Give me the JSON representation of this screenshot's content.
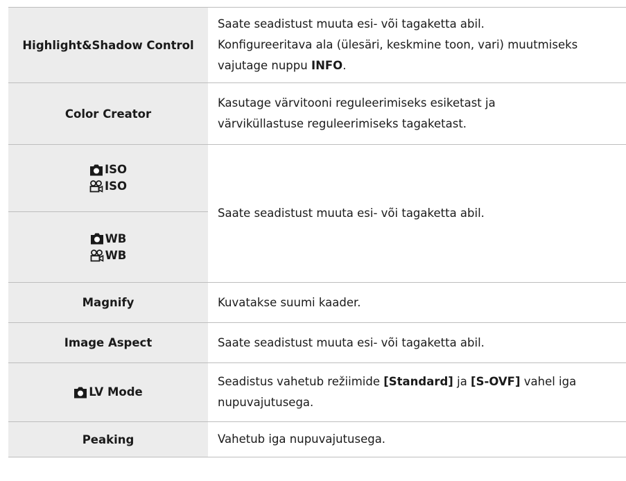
{
  "rows": [
    {
      "label": "Highlight&Shadow Control",
      "desc_line1": "Saate seadistust muuta esi- või tagaketta abil.",
      "desc_line2": "Konfigureeritava ala (ülesäri, keskmine toon, vari) muutmiseks",
      "desc_line3_pre": "vajutage nuppu ",
      "desc_line3_bold": "INFO",
      "desc_line3_post": "."
    },
    {
      "label": "Color Creator",
      "desc_line1": "Kasutage värvitooni reguleerimiseks esiketast ja",
      "desc_line2": "värviküllastuse reguleerimiseks tagaketast."
    },
    {
      "still_iso": "ISO",
      "movie_iso": "ISO",
      "still_wb": "WB",
      "movie_wb": "WB",
      "desc": "Saate seadistust muuta esi- või tagaketta abil."
    },
    {
      "label": "Magnify",
      "desc": "Kuvatakse suumi kaader."
    },
    {
      "label": "Image Aspect",
      "desc": "Saate seadistust muuta esi- või tagaketta abil."
    },
    {
      "label": "LV Mode",
      "desc_pre": "Seadistus vahetub režiimide ",
      "desc_bold1": "[Standard]",
      "desc_mid": " ja ",
      "desc_bold2": "[S-OVF]",
      "desc_post": " vahel iga",
      "desc_line2": "nupuvajutusega."
    },
    {
      "label": "Peaking",
      "desc": "Vahetub iga nupuvajutusega."
    }
  ],
  "icons": [
    "camera-icon",
    "movie-camera-icon"
  ],
  "colors": {
    "label_bg": "#ececec",
    "border": "#bdbdbd",
    "text": "#1a1a1a"
  }
}
